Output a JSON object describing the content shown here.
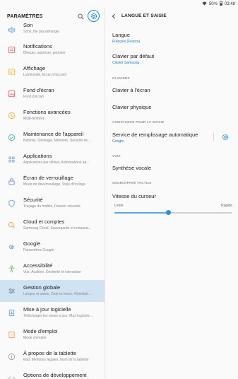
{
  "status": {
    "battery": "50%",
    "time": "03:48"
  },
  "left": {
    "title": "PARAMÈTRES",
    "items": [
      {
        "title": "Son",
        "sub": "Sons, Ne pas déranger",
        "icon": "volume-icon",
        "color": "#5aa4e6"
      },
      {
        "title": "Notifications",
        "sub": "Bloquer, autoriser, prioriser",
        "icon": "notifications-icon",
        "color": "#e57373"
      },
      {
        "title": "Affichage",
        "sub": "Luminosité, Écran d'accueil",
        "icon": "display-icon",
        "color": "#f5b041"
      },
      {
        "title": "Fond d'écran",
        "sub": "Fond d'écran",
        "icon": "wallpaper-icon",
        "color": "#e57373"
      },
      {
        "title": "Fonctions avancées",
        "sub": "Multi-fenêtres",
        "icon": "advanced-icon",
        "color": "#f5b041"
      },
      {
        "title": "Maintenance de l'appareil",
        "sub": "Batterie, Stockage, Mémoire, Sécurité de ...",
        "icon": "maintenance-icon",
        "color": "#4db6ac"
      },
      {
        "title": "Applications",
        "sub": "Applications par défaut, Autorisations ap...",
        "icon": "apps-icon",
        "color": "#5aa4e6"
      },
      {
        "title": "Écran de verrouillage",
        "sub": "Mode de déverrouillage, Style d'horloge",
        "icon": "lock-icon",
        "color": "#7986cb"
      },
      {
        "title": "Sécurité",
        "sub": "Traçage du mobile, Dossier sécurisé",
        "icon": "security-icon",
        "color": "#5aa4e6"
      },
      {
        "title": "Cloud et comptes",
        "sub": "Samsung Cloud, Sauvegarde et restaurat...",
        "icon": "cloud-icon",
        "color": "#f5a04a"
      },
      {
        "title": "Google",
        "sub": "Paramètres Google",
        "icon": "google-icon",
        "color": "#5aa4e6"
      },
      {
        "title": "Accessibilité",
        "sub": "Vue, Audition, Dextérité et interaction",
        "icon": "accessibility-icon",
        "color": "#66bb6a"
      },
      {
        "title": "Gestion globale",
        "sub": "Langue et saisie, Date et heure, Réinitiali...",
        "icon": "general-management-icon",
        "color": "#7c8ea8"
      },
      {
        "title": "Mise à jour logicielle",
        "sub": "Télécharger les mises à jour, MàJ logiciels ...",
        "icon": "software-update-icon",
        "color": "#5aa4e6"
      },
      {
        "title": "Mode d'emploi",
        "sub": "Mode d'emploi",
        "icon": "user-manual-icon",
        "color": "#f5a04a"
      },
      {
        "title": "À propos de la tablette",
        "sub": "État, Mentions légales, Nom de la tablette",
        "icon": "about-icon",
        "color": "#9e9e9e"
      },
      {
        "title": "Options de développement",
        "sub": "",
        "icon": "developer-icon",
        "color": "#9e9e9e"
      }
    ]
  },
  "right": {
    "title": "LANGUE ET SAISIE",
    "language": {
      "title": "Langue",
      "value": "Français (France)"
    },
    "default_keyboard": {
      "title": "Clavier par défaut",
      "value": "Clavier Samsung"
    },
    "section_keyboards": "CLAVIERS",
    "onscreen_keyboard": {
      "title": "Clavier à l'écran"
    },
    "physical_keyboard": {
      "title": "Clavier physique"
    },
    "section_input_assist": "ASSISTANCE POUR LA SAISIE",
    "autofill": {
      "title": "Service de remplissage automatique",
      "value": "Google"
    },
    "section_voice": "VOIX",
    "tts": {
      "title": "Synthèse vocale"
    },
    "section_pointer": "SOURIS/PAVÉ TACTILE",
    "pointer_speed": {
      "title": "Vitesse du curseur",
      "min_label": "Lente",
      "max_label": "Rapide",
      "level": 0.46
    },
    "accent_color": "#2b8fdb"
  }
}
